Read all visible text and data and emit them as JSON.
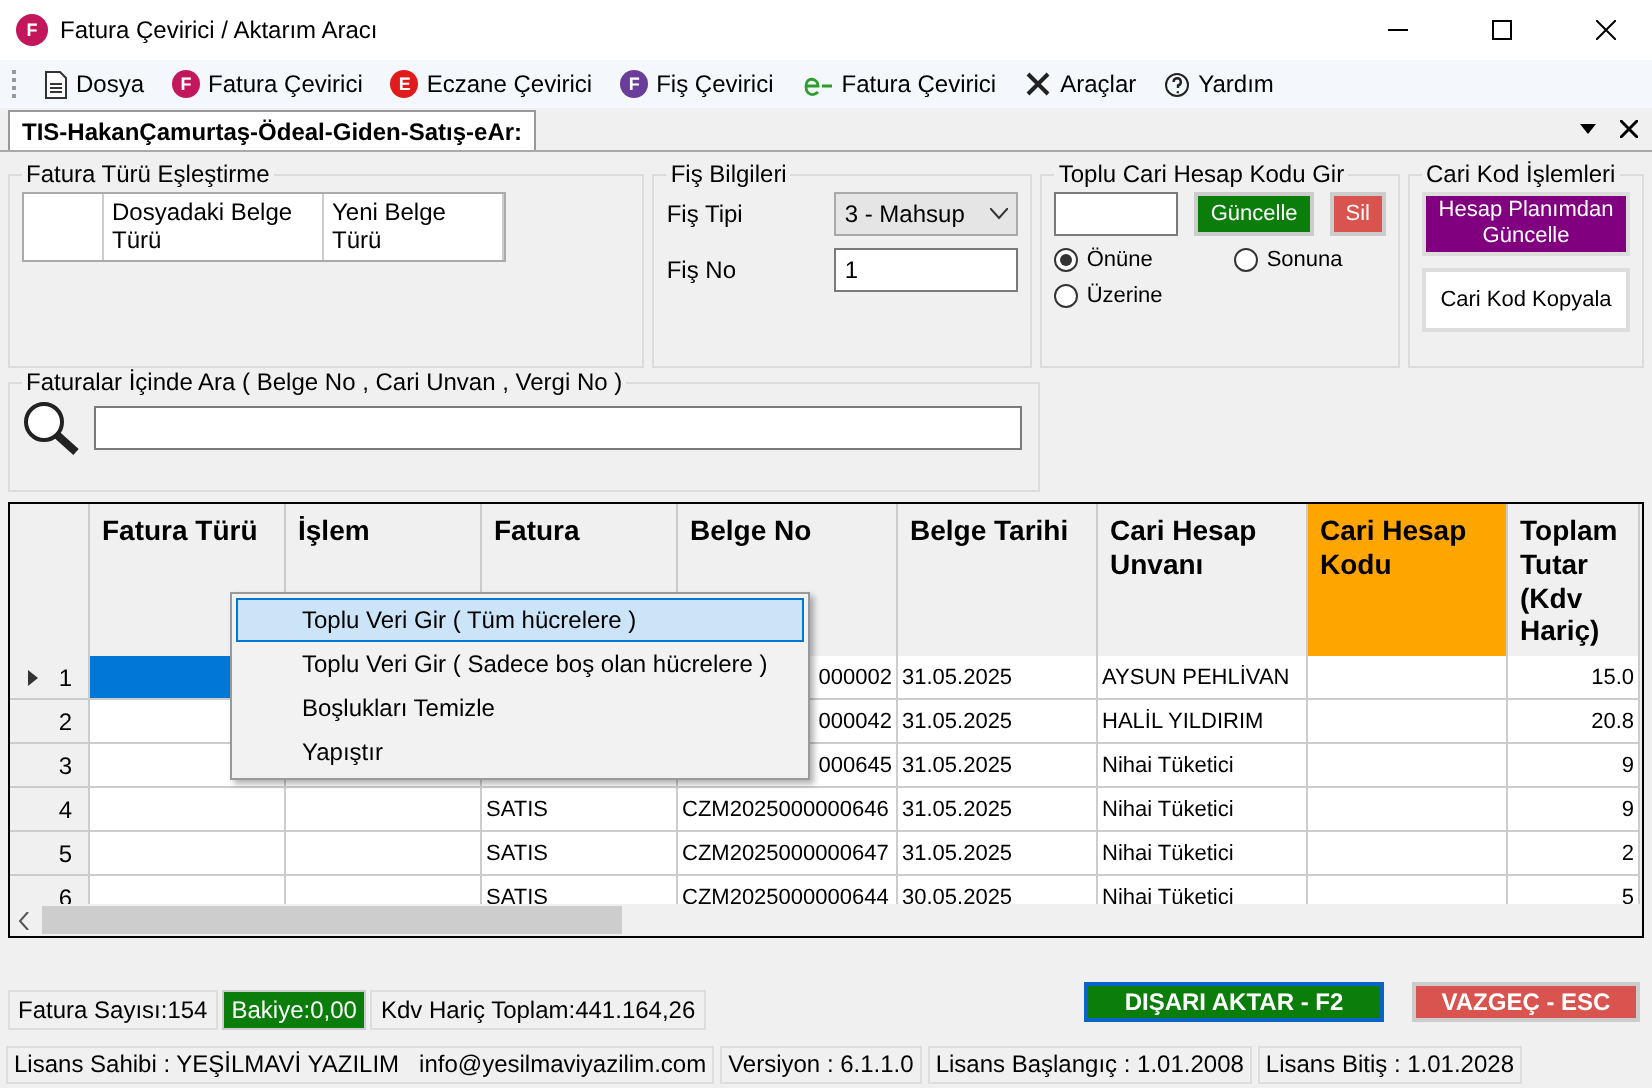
{
  "window": {
    "title": "Fatura Çevirici / Aktarım Aracı",
    "logo": "F"
  },
  "menu": [
    {
      "label": "Dosya",
      "kind": "document"
    },
    {
      "label": "Fatura Çevirici",
      "kind": "badge",
      "badge": "F",
      "color": "#c2185b"
    },
    {
      "label": "Eczane Çevirici",
      "kind": "badge",
      "badge": "E",
      "color": "#e01b1b"
    },
    {
      "label": "Fiş Çevirici",
      "kind": "badge",
      "badge": "F",
      "color": "#6a3d9a"
    },
    {
      "label": "Fatura Çevirici",
      "kind": "e"
    },
    {
      "label": "Araçlar",
      "kind": "tools"
    },
    {
      "label": "Yardım",
      "kind": "help"
    }
  ],
  "tab": {
    "label": "TIS-HakanÇamurtaş-Ödeal-Giden-Satış-eAr:",
    "selected": true
  },
  "mapping": {
    "title": "Fatura Türü Eşleştirme",
    "columns": [
      "Dosyadaki Belge Türü",
      "Yeni Belge Türü"
    ]
  },
  "fis": {
    "title": "Fiş Bilgileri",
    "tipi_label": "Fiş Tipi",
    "tipi": "3 - Mahsup",
    "no_label": "Fiş No",
    "no": "1"
  },
  "toplu": {
    "title": "Toplu Cari Hesap Kodu Gir",
    "update": "Güncelle",
    "delete": "Sil",
    "options": [
      {
        "label": "Önüne",
        "selected": true
      },
      {
        "label": "Sonuna",
        "selected": false
      },
      {
        "label": "Üzerine",
        "selected": false
      }
    ]
  },
  "cari": {
    "title": "Cari Kod İşlemleri",
    "update": "Hesap Planımdan Güncelle",
    "copy": "Cari Kod Kopyala"
  },
  "search": {
    "title": "Faturalar İçinde Ara ( Belge No , Cari Unvan , Vergi No )"
  },
  "table": {
    "columns": [
      {
        "label": "Fatura Türü",
        "highlight": false
      },
      {
        "label": "İşlem",
        "highlight": false
      },
      {
        "label": "Fatura",
        "highlight": false
      },
      {
        "label": "Belge No",
        "highlight": false
      },
      {
        "label": "Belge Tarihi",
        "highlight": false
      },
      {
        "label": "Cari Hesap Unvanı",
        "highlight": false
      },
      {
        "label": "Cari Hesap Kodu",
        "highlight": true
      },
      {
        "label": "Toplam Tutar (Kdv Hariç)",
        "highlight": false
      }
    ],
    "rows": [
      {
        "num": "1",
        "selected": true,
        "cells": [
          "",
          null,
          null,
          "000002",
          "31.05.2025",
          "AYSUN PEHLİVAN",
          "",
          "15.0"
        ]
      },
      {
        "num": "2",
        "selected": false,
        "cells": [
          "",
          null,
          null,
          "000042",
          "31.05.2025",
          "HALİL YILDIRIM",
          "",
          "20.8"
        ]
      },
      {
        "num": "3",
        "selected": false,
        "cells": [
          "",
          null,
          null,
          "000645",
          "31.05.2025",
          "Nihai Tüketici",
          "",
          "9"
        ]
      },
      {
        "num": "4",
        "selected": false,
        "cells": [
          "",
          "",
          "SATIS",
          "CZM2025000000646",
          "31.05.2025",
          "Nihai Tüketici",
          "",
          "9"
        ]
      },
      {
        "num": "5",
        "selected": false,
        "cells": [
          "",
          "",
          "SATIS",
          "CZM2025000000647",
          "31.05.2025",
          "Nihai Tüketici",
          "",
          "2"
        ]
      },
      {
        "num": "6",
        "selected": false,
        "cells": [
          "",
          "",
          "SATIS",
          "CZM2025000000644",
          "30.05.2025",
          "Nihai Tüketici",
          "",
          "5"
        ]
      }
    ]
  },
  "context_menu": [
    {
      "label": "Toplu Veri Gir ( Tüm hücrelere )",
      "selected": true
    },
    {
      "label": "Toplu Veri Gir ( Sadece boş olan hücrelere )",
      "selected": false
    },
    {
      "label": "Boşlukları Temizle",
      "selected": false
    },
    {
      "label": "Yapıştır",
      "selected": false
    }
  ],
  "summary": [
    {
      "text": "Fatura Sayısı:154",
      "kind": "plain"
    },
    {
      "text": "Bakiye:0,00",
      "kind": "green"
    },
    {
      "text": "Kdv Hariç Toplam:441.164,26",
      "kind": "plain"
    }
  ],
  "buttons": {
    "export": "DIŞARI AKTAR - F2",
    "cancel": "VAZGEÇ - ESC"
  },
  "license": [
    "Lisans Sahibi : YEŞİLMAVİ YAZILIM   info@yesilmaviyazilim.com",
    "Versiyon : 6.1.1.0",
    "Lisans Başlangıç : 1.01.2008",
    "Lisans Bitiş : 1.01.2028"
  ]
}
